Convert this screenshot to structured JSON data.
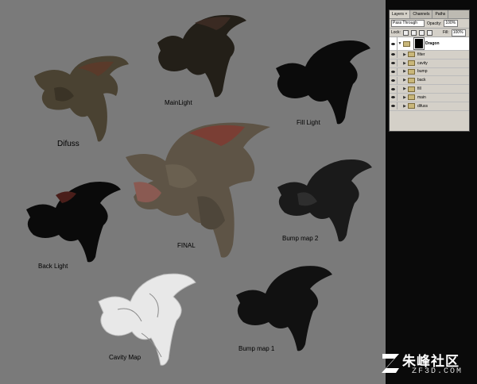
{
  "labels": {
    "difuss": "Difuss",
    "mainlight": "MainLight",
    "fill_light": "Fill Light",
    "final": "FINAL",
    "back_light": "Back Light",
    "bump_map_2": "Bump map 2",
    "cavity_map": "Cavity Map",
    "bump_map_1": "Bump map 1"
  },
  "layers_panel": {
    "tabs": [
      {
        "label": "Layers ×"
      },
      {
        "label": "Channels"
      },
      {
        "label": "Paths"
      }
    ],
    "blend_mode": "Pass Through",
    "opacity_label": "Opacity:",
    "opacity_value": "100%",
    "lock_label": "Lock:",
    "fill_label": "Fill:",
    "fill_value": "100%",
    "group_name": "Dragon",
    "layers": [
      {
        "name": "filter"
      },
      {
        "name": "cavity"
      },
      {
        "name": "bump"
      },
      {
        "name": "back"
      },
      {
        "name": "fill"
      },
      {
        "name": "main"
      },
      {
        "name": "difuss"
      }
    ]
  },
  "watermark": {
    "text": "朱峰社区",
    "sub": "ZF3D.COM"
  },
  "colors": {
    "canvas_bg": "#7a7a7a",
    "panel_bg": "#d4d0c8"
  }
}
